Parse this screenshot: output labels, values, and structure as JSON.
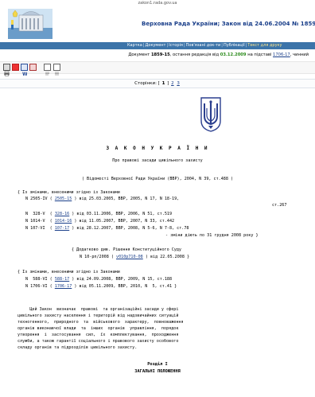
{
  "browser": {
    "url": "zakon1.rada.gov.ua"
  },
  "header": {
    "site_title": "Верховна Рада України;  Закон  від 24.06.2004  № 1859-IV"
  },
  "menu": {
    "items": [
      "Картка",
      "Документ",
      "Історія",
      "Пов'язані док-ти",
      "Публікації",
      "Текст для друку"
    ],
    "active_index": 5
  },
  "docinfo": {
    "prefix": "Документ",
    "number": "1859-15",
    "mid": ", остання редакція від",
    "date": "03.12.2009",
    "basis_prefix": "на підставі",
    "basis_link": "1706-17",
    "suffix": ", чинний"
  },
  "toolbar": {
    "icons": [
      "print-icon",
      "pdf-icon",
      "word-icon",
      "save-icon",
      "html-icon",
      "text-icon"
    ]
  },
  "pagination": {
    "label": "Сторінки:",
    "current": "1",
    "pages": [
      "2",
      "3"
    ]
  },
  "law": {
    "title": "З А К О Н   У К Р А Ї Н И",
    "subtitle": "Про правові засади цивільного захисту",
    "source": "( Відомості Верховної Ради України (ВВР), 2004, N 39, ст.488 )",
    "amend1": {
      "intro": "{ Із змінами, внесеними згідно із Законами",
      "rows": [
        {
          "pre": "N 2505-IV (",
          "link": "2505-15",
          "post": ") від 25.03.2005, ВВР, 2005, N 17, N 18-19,"
        },
        {
          "pre": "",
          "link": "",
          "post": "ст.267"
        },
        {
          "pre": "N  328-V  (",
          "link": "328-16",
          "post": ") від 03.11.2006, ВВР, 2006, N 51, ст.519"
        },
        {
          "pre": "N 1014-V  (",
          "link": "1014-16",
          "post": ") від 11.05.2007, ВВР, 2007, N 33, ст.442"
        },
        {
          "pre": "N 107-VI  (",
          "link": "107-17",
          "post": ") від 28.12.2007, ВВР, 2008, N 5-6, N 7-8, ст.78"
        },
        {
          "pre": "",
          "link": "",
          "post": "- зміни діють по 31 грудня 2008 року }"
        }
      ]
    },
    "ccu": {
      "line1": "{ Додатково див. Рішення Конституційного Суду",
      "pre": "N 10-рп/2008 (",
      "link": "v010p710-08",
      "post": ") від 22.05.2008 }"
    },
    "amend2": {
      "intro": "{ Із змінами, внесеними згідно із Законами",
      "rows": [
        {
          "pre": "N  588-VI (",
          "link": "588-17",
          "post": ") від 24.09.2008, ВВР, 2009, N 15, ст.188"
        },
        {
          "pre": "N 1706-VI (",
          "link": "1706-17",
          "post": ") від 05.11.2009, ВВР, 2010, N  5, ст.41 }"
        }
      ]
    },
    "paragraph": [
      "     Цей Закон  визначає  правові  та організаційні засади у сфері",
      "цивільного захисту населення і територій від надзвичайних ситуацій",
      "техногенного,  природного  та  військового  характеру,  повноваження",
      "органів виконавчої влади  та  інших  органів  управління,  порядок",
      "утворення  і  застосування  сил,  їх  комплектування,  проходження",
      "служби, а також гарантії соціального і правового захисту особового",
      "складу органів та підрозділів цивільного захисту."
    ],
    "section": "Розділ I",
    "section_title": "ЗАГАЛЬНІ ПОЛОЖЕННЯ"
  },
  "colors": {
    "menubar": "#3c74a9",
    "link": "#1a3f8a",
    "date_green": "#2a8a1a",
    "emblem": "#2b3f8f"
  }
}
